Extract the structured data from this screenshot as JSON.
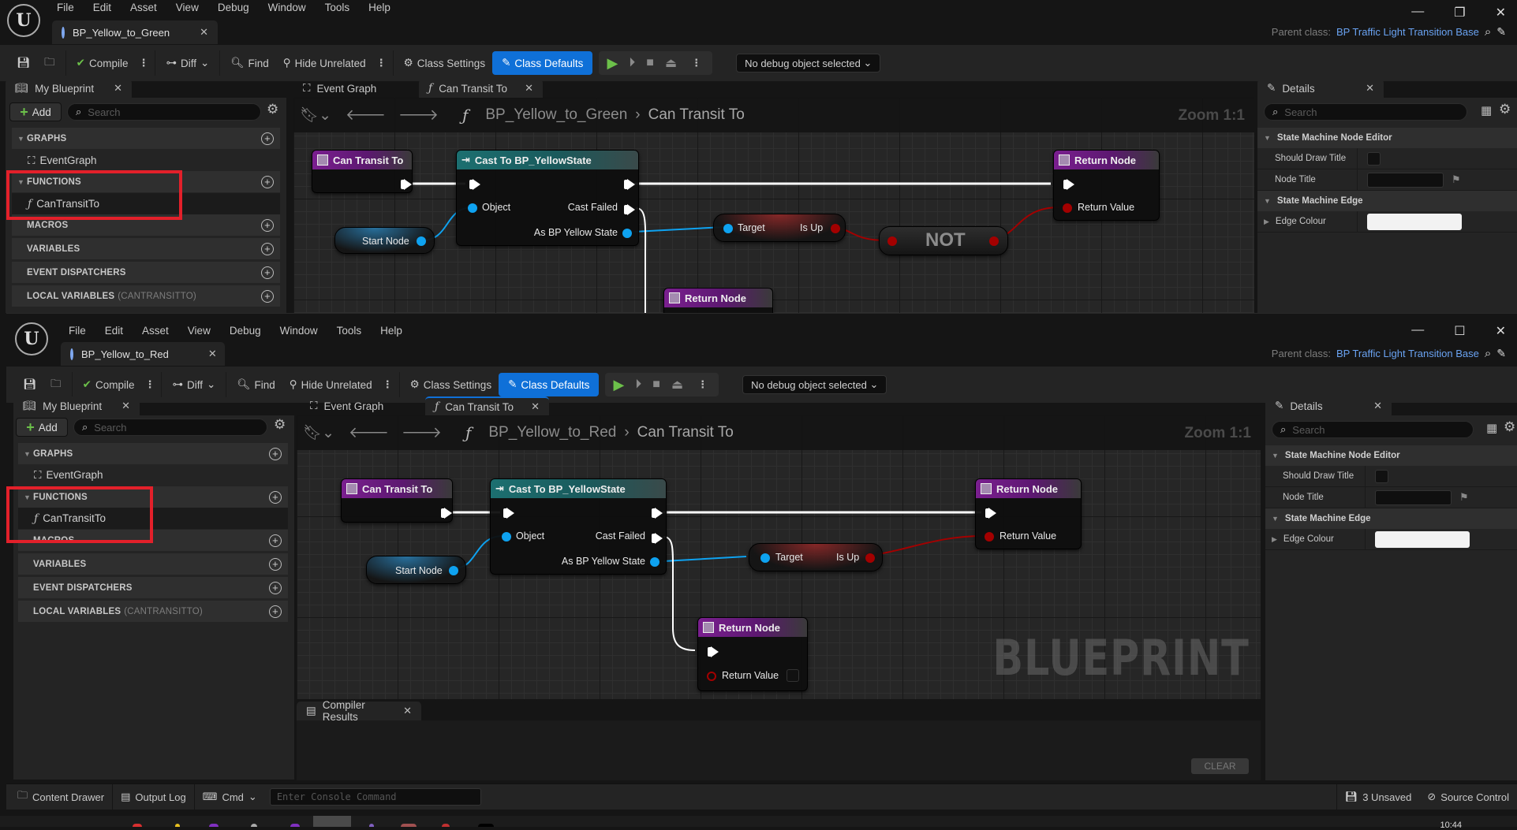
{
  "windows": [
    {
      "id": "top",
      "menu": [
        "File",
        "Edit",
        "Asset",
        "View",
        "Debug",
        "Window",
        "Tools",
        "Help"
      ],
      "asset_tab": "BP_Yellow_to_Green",
      "parent_class_label": "Parent class:",
      "parent_class_value": "BP Traffic Light Transition Base",
      "toolbar": {
        "compile": "Compile",
        "diff": "Diff",
        "find": "Find",
        "hide_unrelated": "Hide Unrelated",
        "class_settings": "Class Settings",
        "class_defaults": "Class Defaults",
        "debug_object": "No debug object selected"
      },
      "my_blueprint": {
        "tab": "My Blueprint",
        "add": "Add",
        "search_placeholder": "Search",
        "sections": {
          "graphs": "GRAPHS",
          "functions": "FUNCTIONS",
          "macros": "MACROS",
          "variables": "VARIABLES",
          "event_dispatchers": "EVENT DISPATCHERS",
          "local_variables": "LOCAL VARIABLES",
          "local_variables_scope": "(CANTRANSITTO)"
        },
        "event_graph": "EventGraph",
        "function_item": "CanTransitTo"
      },
      "graph_tabs": [
        "Event Graph",
        "Can Transit To"
      ],
      "breadcrumb": [
        "BP_Yellow_to_Green",
        "Can Transit To"
      ],
      "zoom": "Zoom 1:1",
      "nodes": {
        "entry": "Can Transit To",
        "cast": "Cast To BP_YellowState",
        "cast_object": "Object",
        "cast_failed": "Cast Failed",
        "cast_as": "As BP Yellow State",
        "start_node": "Start Node",
        "target": "Target",
        "is_up": "Is Up",
        "not": "NOT",
        "return_node": "Return Node",
        "return_value": "Return Value",
        "return_node_2": "Return Node"
      },
      "details": {
        "tab": "Details",
        "search_placeholder": "Search",
        "section1": "State Machine Node Editor",
        "should_draw_title": "Should Draw Title",
        "should_draw_title_value": false,
        "node_title": "Node Title",
        "node_title_value": "",
        "section2": "State Machine Edge",
        "edge_colour": "Edge Colour",
        "edge_colour_value": "#f2f2f2"
      }
    },
    {
      "id": "bottom",
      "menu": [
        "File",
        "Edit",
        "Asset",
        "View",
        "Debug",
        "Window",
        "Tools",
        "Help"
      ],
      "asset_tab": "BP_Yellow_to_Red",
      "parent_class_label": "Parent class:",
      "parent_class_value": "BP Traffic Light Transition Base",
      "toolbar": {
        "compile": "Compile",
        "diff": "Diff",
        "find": "Find",
        "hide_unrelated": "Hide Unrelated",
        "class_settings": "Class Settings",
        "class_defaults": "Class Defaults",
        "debug_object": "No debug object selected"
      },
      "my_blueprint": {
        "tab": "My Blueprint",
        "add": "Add",
        "search_placeholder": "Search",
        "sections": {
          "graphs": "GRAPHS",
          "functions": "FUNCTIONS",
          "macros": "MACROS",
          "variables": "VARIABLES",
          "event_dispatchers": "EVENT DISPATCHERS",
          "local_variables": "LOCAL VARIABLES",
          "local_variables_scope": "(CANTRANSITTO)"
        },
        "event_graph": "EventGraph",
        "function_item": "CanTransitTo"
      },
      "graph_tabs": [
        "Event Graph",
        "Can Transit To"
      ],
      "breadcrumb": [
        "BP_Yellow_to_Red",
        "Can Transit To"
      ],
      "zoom": "Zoom 1:1",
      "watermark": "BLUEPRINT",
      "nodes": {
        "entry": "Can Transit To",
        "cast": "Cast To BP_YellowState",
        "cast_object": "Object",
        "cast_failed": "Cast Failed",
        "cast_as": "As BP Yellow State",
        "start_node": "Start Node",
        "target": "Target",
        "is_up": "Is Up",
        "return_node": "Return Node",
        "return_value": "Return Value",
        "return_node_2": "Return Node",
        "return_value_2": "Return Value",
        "return_value_2_checked": false
      },
      "details": {
        "tab": "Details",
        "search_placeholder": "Search",
        "section1": "State Machine Node Editor",
        "should_draw_title": "Should Draw Title",
        "should_draw_title_value": false,
        "node_title": "Node Title",
        "node_title_value": "",
        "section2": "State Machine Edge",
        "edge_colour": "Edge Colour",
        "edge_colour_value": "#f2f2f2"
      },
      "compiler_results": {
        "tab": "Compiler Results",
        "clear": "CLEAR"
      },
      "statusbar": {
        "content_drawer": "Content Drawer",
        "output_log": "Output Log",
        "cmd": "Cmd",
        "console_placeholder": "Enter Console Command",
        "unsaved": "3 Unsaved",
        "source_control": "Source Control"
      }
    }
  ],
  "colors": {
    "accent": "#0f70d8",
    "parent_class_link": "#6aa3f2",
    "highlight_box": "#e3202a",
    "exec_wire": "#ffffff",
    "object_wire": "#0ea2f0",
    "bool_wire": "#a30000"
  },
  "taskbar": {
    "clock": "10:44"
  }
}
